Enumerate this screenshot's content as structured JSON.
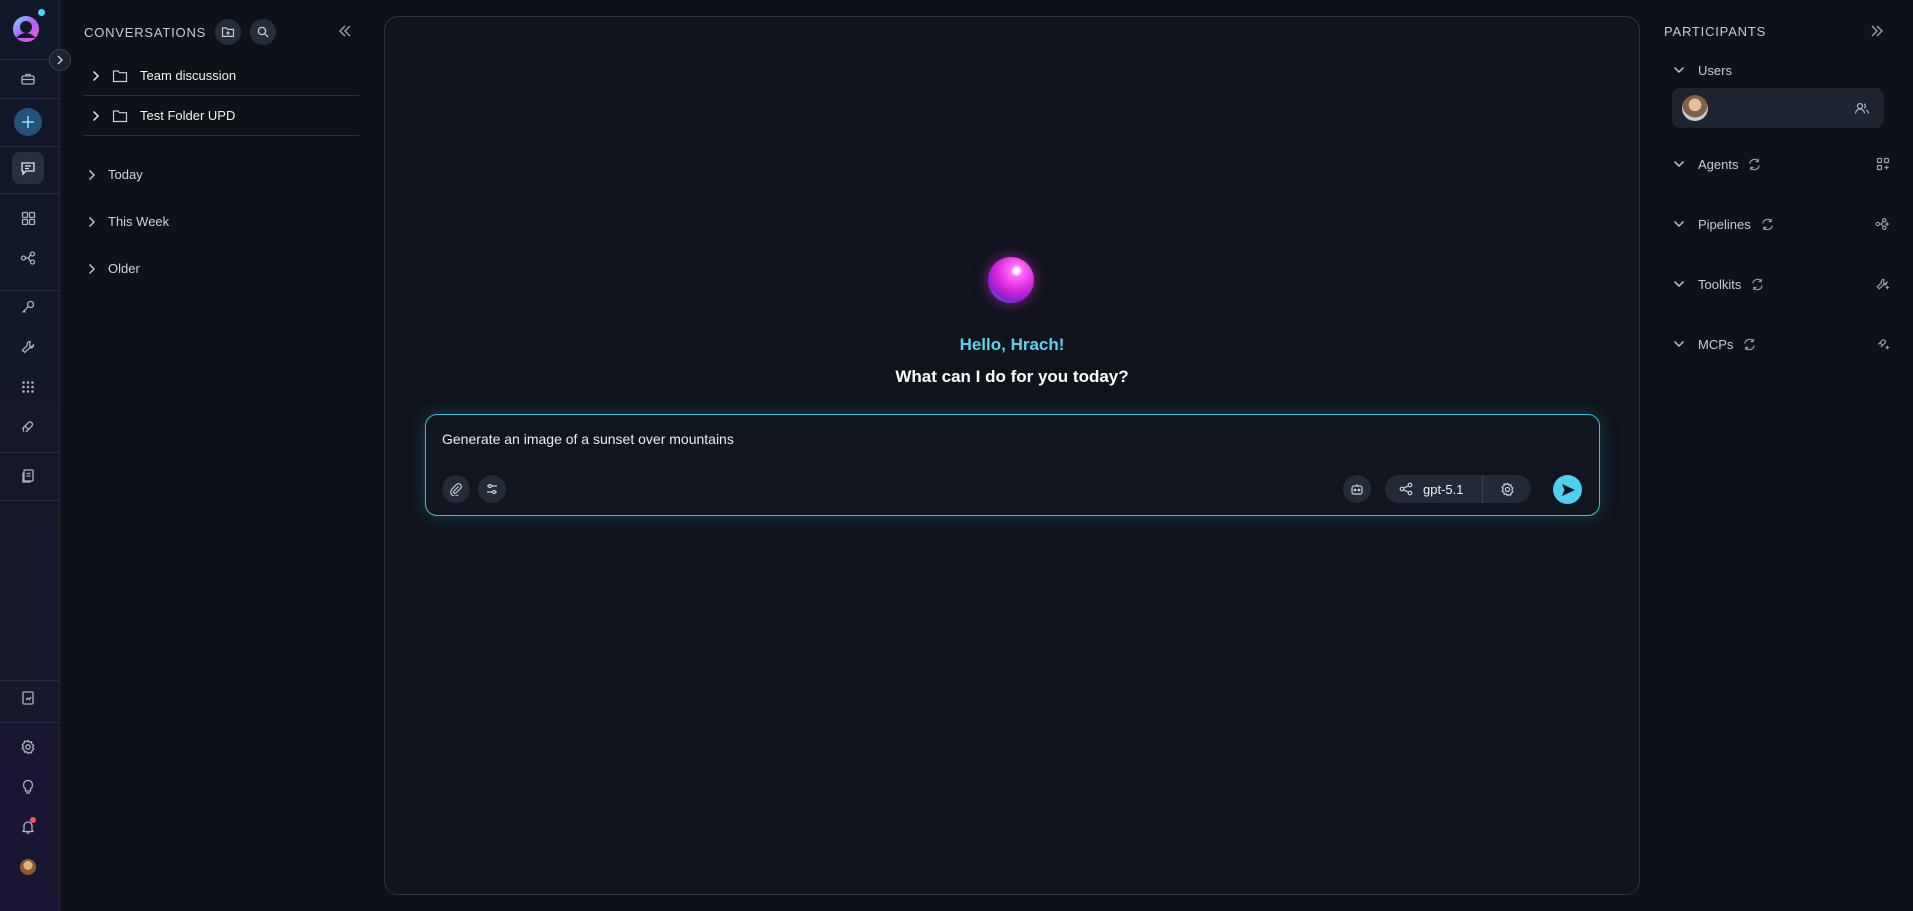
{
  "conversations": {
    "title": "CONVERSATIONS",
    "folders": [
      {
        "label": "Team discussion"
      },
      {
        "label": "Test Folder UPD"
      }
    ],
    "groups": [
      {
        "label": "Today"
      },
      {
        "label": "This Week"
      },
      {
        "label": "Older"
      }
    ]
  },
  "chat": {
    "greeting": "Hello, Hrach!",
    "subtitle": "What can I do for you today?",
    "input_value": "Generate an image of a sunset over mountains",
    "model": "gpt-5.1"
  },
  "participants": {
    "title": "PARTICIPANTS",
    "sections": [
      {
        "label": "Users"
      },
      {
        "label": "Agents"
      },
      {
        "label": "Pipelines"
      },
      {
        "label": "Toolkits"
      },
      {
        "label": "MCPs"
      }
    ]
  },
  "colors": {
    "accent": "#4fd0ef",
    "background": "#0e1117",
    "panel_border": "#2c3443"
  }
}
